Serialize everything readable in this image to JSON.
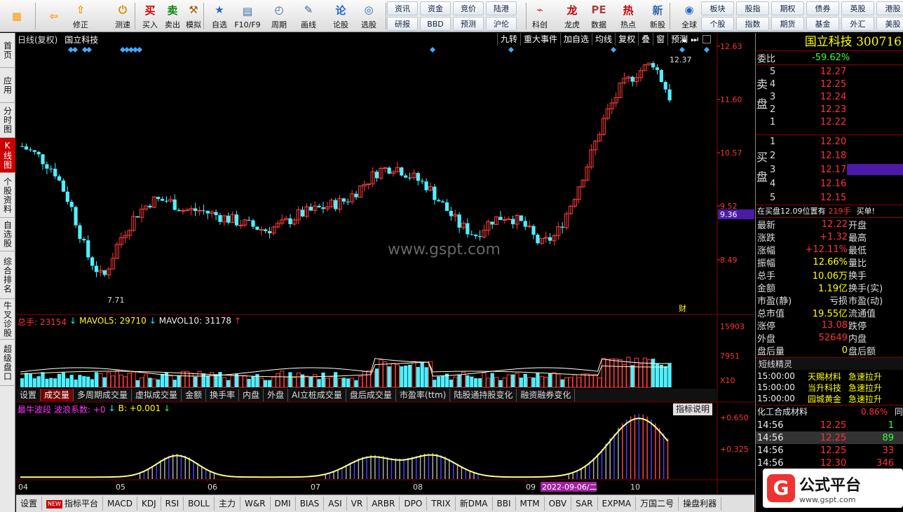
{
  "toolbar": {
    "items": [
      {
        "name": "menu",
        "label": ""
      },
      {
        "name": "back",
        "label": ""
      },
      {
        "name": "modify",
        "label": "修正"
      },
      {
        "name": "test-speed",
        "label": "测速"
      },
      {
        "name": "buy",
        "label": "买入"
      },
      {
        "name": "sell",
        "label": "卖出"
      },
      {
        "name": "simulate",
        "label": "模拟"
      },
      {
        "name": "watchlist",
        "label": "自选"
      },
      {
        "name": "f10",
        "label": "F10/F9"
      },
      {
        "name": "period",
        "label": "周期"
      },
      {
        "name": "draw",
        "label": "画线"
      },
      {
        "name": "forum",
        "label": "论股"
      },
      {
        "name": "stock-select",
        "label": "选股"
      },
      {
        "name": "science-innovation",
        "label": "科创"
      },
      {
        "name": "dragon-tiger",
        "label": "龙虎"
      },
      {
        "name": "data",
        "label": "数据"
      },
      {
        "name": "hot",
        "label": "热点"
      },
      {
        "name": "new-stock",
        "label": "新股"
      },
      {
        "name": "global",
        "label": "全球"
      }
    ],
    "small": [
      [
        "资讯",
        "资金",
        "竞价",
        "陆港"
      ],
      [
        "研报",
        "BBD",
        "预测",
        "沪伦"
      ],
      [
        "板块",
        "股指",
        "期权",
        "债券",
        "英股",
        "港股"
      ],
      [
        "个股",
        "指数",
        "期货",
        "基金",
        "外汇",
        "美股"
      ]
    ]
  },
  "sidebar": [
    "首页",
    "应用",
    "分时图",
    "K线图",
    "个股资料",
    "自选股",
    "综合排名",
    "牛叉诊股",
    "超级盘口"
  ],
  "chart": {
    "header_left": "日线(复权)",
    "stock_name": "国立科技",
    "buttons": [
      "九转",
      "重大事件",
      "加自选",
      "均线",
      "复权",
      "叠",
      "窗",
      "预测"
    ],
    "price_labels": [
      "12.63",
      "11.60",
      "10.57",
      "9.52",
      "8.49"
    ],
    "current_price_tag": "9.36",
    "high_label": "12.37",
    "low_label": "7.71",
    "cai_label": "财",
    "watermark": "www.gspt.com",
    "volume_header": {
      "total": "总手: 23154",
      "mavol5": "MAVOL5: 29710",
      "mavol10": "MAVOL10: 31178"
    },
    "volume_labels": [
      "15903",
      "7951",
      "X10"
    ],
    "vol_tabs": [
      "设置",
      "成交量",
      "多周期成交量",
      "虚拟成交量",
      "金额",
      "换手率",
      "内盘",
      "外盘",
      "AI立桩成交量",
      "盘后成交量",
      "市盈率(ttm)",
      "陆股通持股变化",
      "融资融券变化"
    ],
    "indicator_header": {
      "name": "最牛波段",
      "coef": "波浪系数: +0",
      "b": "B: +0.001"
    },
    "indicator_btn": "指标说明",
    "indicator_labels": [
      "+0.650",
      "+0.325"
    ],
    "months": [
      "04",
      "05",
      "06",
      "07",
      "08",
      "09",
      "10"
    ],
    "date_badge": "2022-09-06/二"
  },
  "bottom_tabs": [
    "设置",
    "指标平台",
    "MACD",
    "KDJ",
    "RSI",
    "BOLL",
    "主力",
    "W&R",
    "DMI",
    "BIAS",
    "ASI",
    "VR",
    "ARBR",
    "DPO",
    "TRIX",
    "新DMA",
    "BBI",
    "MTM",
    "OBV",
    "SAR",
    "EXPMA",
    "万国二号",
    "操盘利器"
  ],
  "bottom_new": "NEW",
  "quote": {
    "title": "国立科技 300716",
    "weibi_label": "委比",
    "weibi_value": "-59.62%",
    "sell_label": "卖盘",
    "buy_label": "买盘",
    "sells": [
      [
        "5",
        "12.27"
      ],
      [
        "4",
        "12.25"
      ],
      [
        "3",
        "12.24"
      ],
      [
        "2",
        "12.23"
      ],
      [
        "1",
        "12.22"
      ]
    ],
    "buys": [
      [
        "1",
        "12.20"
      ],
      [
        "2",
        "12.18"
      ],
      [
        "3",
        "12.17"
      ],
      [
        "4",
        "12.16"
      ],
      [
        "5",
        "12.15"
      ]
    ],
    "position_note": "在买盘12.09位置有",
    "position_qty": "219手",
    "position_action": "买单!",
    "stats": [
      {
        "k": "最新",
        "v": "12.22",
        "c": "red",
        "k2": "开盘"
      },
      {
        "k": "涨跌",
        "v": "+1.32",
        "c": "red",
        "k2": "最高"
      },
      {
        "k": "涨幅",
        "v": "+12.11%",
        "c": "red",
        "k2": "最低"
      },
      {
        "k": "振幅",
        "v": "12.66%",
        "c": "yellow",
        "k2": "量比"
      },
      {
        "k": "总手",
        "v": "10.06万",
        "c": "yellow",
        "k2": "换手"
      },
      {
        "k": "金额",
        "v": "1.19亿",
        "c": "yellow",
        "k2": "换手(实)"
      },
      {
        "k": "市盈(静)",
        "v": "亏损",
        "c": "white",
        "k2": "市盈(动)"
      },
      {
        "k": "总市值",
        "v": "19.55亿",
        "c": "yellow",
        "k2": "流通值"
      },
      {
        "k": "涨停",
        "v": "13.08",
        "c": "red",
        "k2": "跌停"
      },
      {
        "k": "外盘",
        "v": "52649",
        "c": "red",
        "k2": "内盘"
      },
      {
        "k": "盘后量",
        "v": "0",
        "c": "yellow",
        "k2": "盘后额"
      }
    ],
    "short_title": "短线精灵",
    "short_items": [
      [
        "15:00:00",
        "天赐材料",
        "急速拉升"
      ],
      [
        "15:00:00",
        "当升科技",
        "急速拉升"
      ],
      [
        "15:00:00",
        "园城黄金",
        "急速拉升"
      ]
    ],
    "sector_name": "化工合成材料",
    "sector_pct": "0.86%",
    "sector_tail": "同",
    "ticks": [
      [
        "14:56",
        "12.25",
        "1"
      ],
      [
        "14:56",
        "12.25",
        "89"
      ],
      [
        "14:56",
        "12.25",
        "33"
      ],
      [
        "14:56",
        "12.30",
        "346"
      ]
    ],
    "logo_text": "公式平台",
    "logo_url": "www.gspt.com"
  },
  "colors": {
    "up": "#ff3c3c",
    "down": "#4ff0ff",
    "ma5": "#ffffff",
    "accent": "#c00000"
  }
}
